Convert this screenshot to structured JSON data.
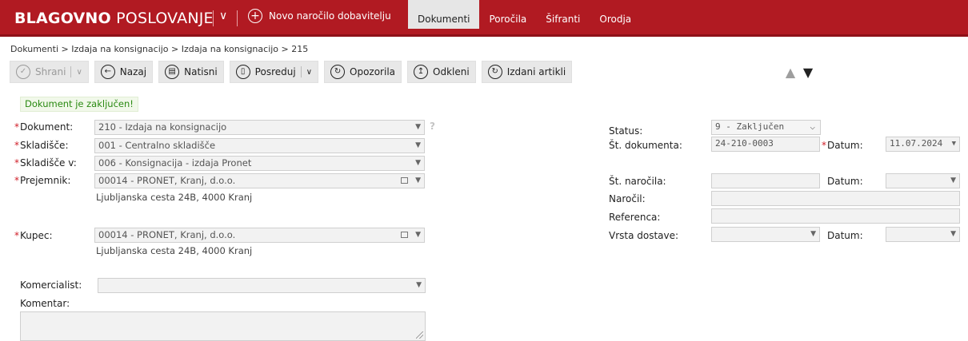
{
  "topbar": {
    "brand_bold": "BLAGOVNO",
    "brand_light": "POSLOVANJE",
    "new_order": "Novo naročilo dobavitelju",
    "nav": [
      "Dokumenti",
      "Poročila",
      "Šifranti",
      "Orodja"
    ],
    "active_nav": "Dokumenti",
    "brand_color": "#b11a22"
  },
  "breadcrumb": "Dokumenti > Izdaja na konsignacijo > Izdaja na konsignacijo > 215",
  "toolbar": {
    "save": "Shrani",
    "back": "Nazaj",
    "print": "Natisni",
    "forward": "Posreduj",
    "warnings": "Opozorila",
    "unlock": "Odkleni",
    "issued_items": "Izdani artikli"
  },
  "message": "Dokument je zaključen!",
  "form": {
    "document_label": "Dokument:",
    "document_value": "210 - Izdaja na konsignacijo",
    "warehouse_label": "Skladišče:",
    "warehouse_value": "001 - Centralno skladišče",
    "warehouse_to_label": "Skladišče v:",
    "warehouse_to_value": "006 - Konsignacija - izdaja Pronet",
    "recipient_label": "Prejemnik:",
    "recipient_value": "00014 - PRONET, Kranj, d.o.o.",
    "recipient_address": "Ljubljanska cesta 24B, 4000 Kranj",
    "buyer_label": "Kupec:",
    "buyer_value": "00014 - PRONET, Kranj, d.o.o.",
    "buyer_address": "Ljubljanska cesta 24B, 4000 Kranj",
    "commercialist_label": "Komercialist:",
    "commercialist_value": "",
    "comment_label": "Komentar:",
    "help": "?",
    "status_label": "Status:",
    "status_value": "9 - Zaključen",
    "doc_number_label": "Št. dokumenta:",
    "doc_number_value": "24-210-0003",
    "date_label": "Datum:",
    "date_value": "11.07.2024",
    "order_number_label": "Št. naročila:",
    "order_number_value": "",
    "order_date_label": "Datum:",
    "order_date_value": "",
    "ordered_by_label": "Naročil:",
    "ordered_by_value": "",
    "reference_label": "Referenca:",
    "reference_value": "",
    "delivery_type_label": "Vrsta dostave:",
    "delivery_type_value": "",
    "delivery_date_label": "Datum:",
    "delivery_date_value": ""
  }
}
